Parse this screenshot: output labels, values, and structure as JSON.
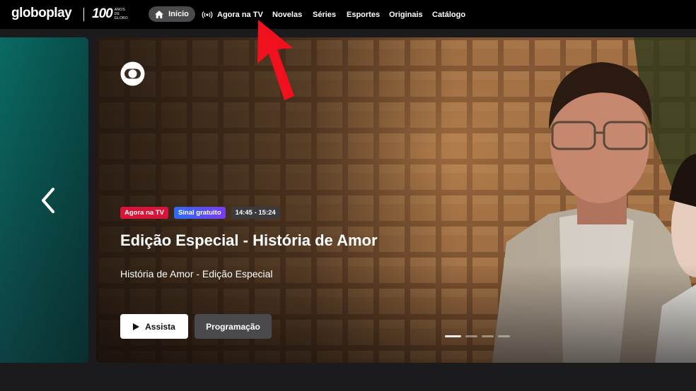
{
  "nav": {
    "logo": "globoplay",
    "anniversary_number": "100",
    "anniversary_text": "ANOS DE GLOBO",
    "home": "Início",
    "items": [
      "Agora na TV",
      "Novelas",
      "Séries",
      "Esportes",
      "Originais",
      "Catálogo"
    ]
  },
  "hero": {
    "badges": {
      "live": "Agora na TV",
      "free": "Sinal gratuito",
      "time": "14:45 - 15:24"
    },
    "title": "Edição Especial - História de Amor",
    "subtitle": "História de Amor - Edição Especial",
    "watch_button": "Assista",
    "schedule_button": "Programação",
    "slides_total": 4,
    "slide_active": 1
  },
  "colors": {
    "live_badge": "#d8143a",
    "free_badge_start": "#2c6cf5",
    "free_badge_end": "#7a3cf0",
    "annotation_arrow": "#f0101e"
  },
  "icons": {
    "home": "home-icon",
    "live": "live-broadcast-icon",
    "globo": "globo-logo-icon",
    "prev": "chevron-left-icon",
    "play": "play-icon"
  }
}
